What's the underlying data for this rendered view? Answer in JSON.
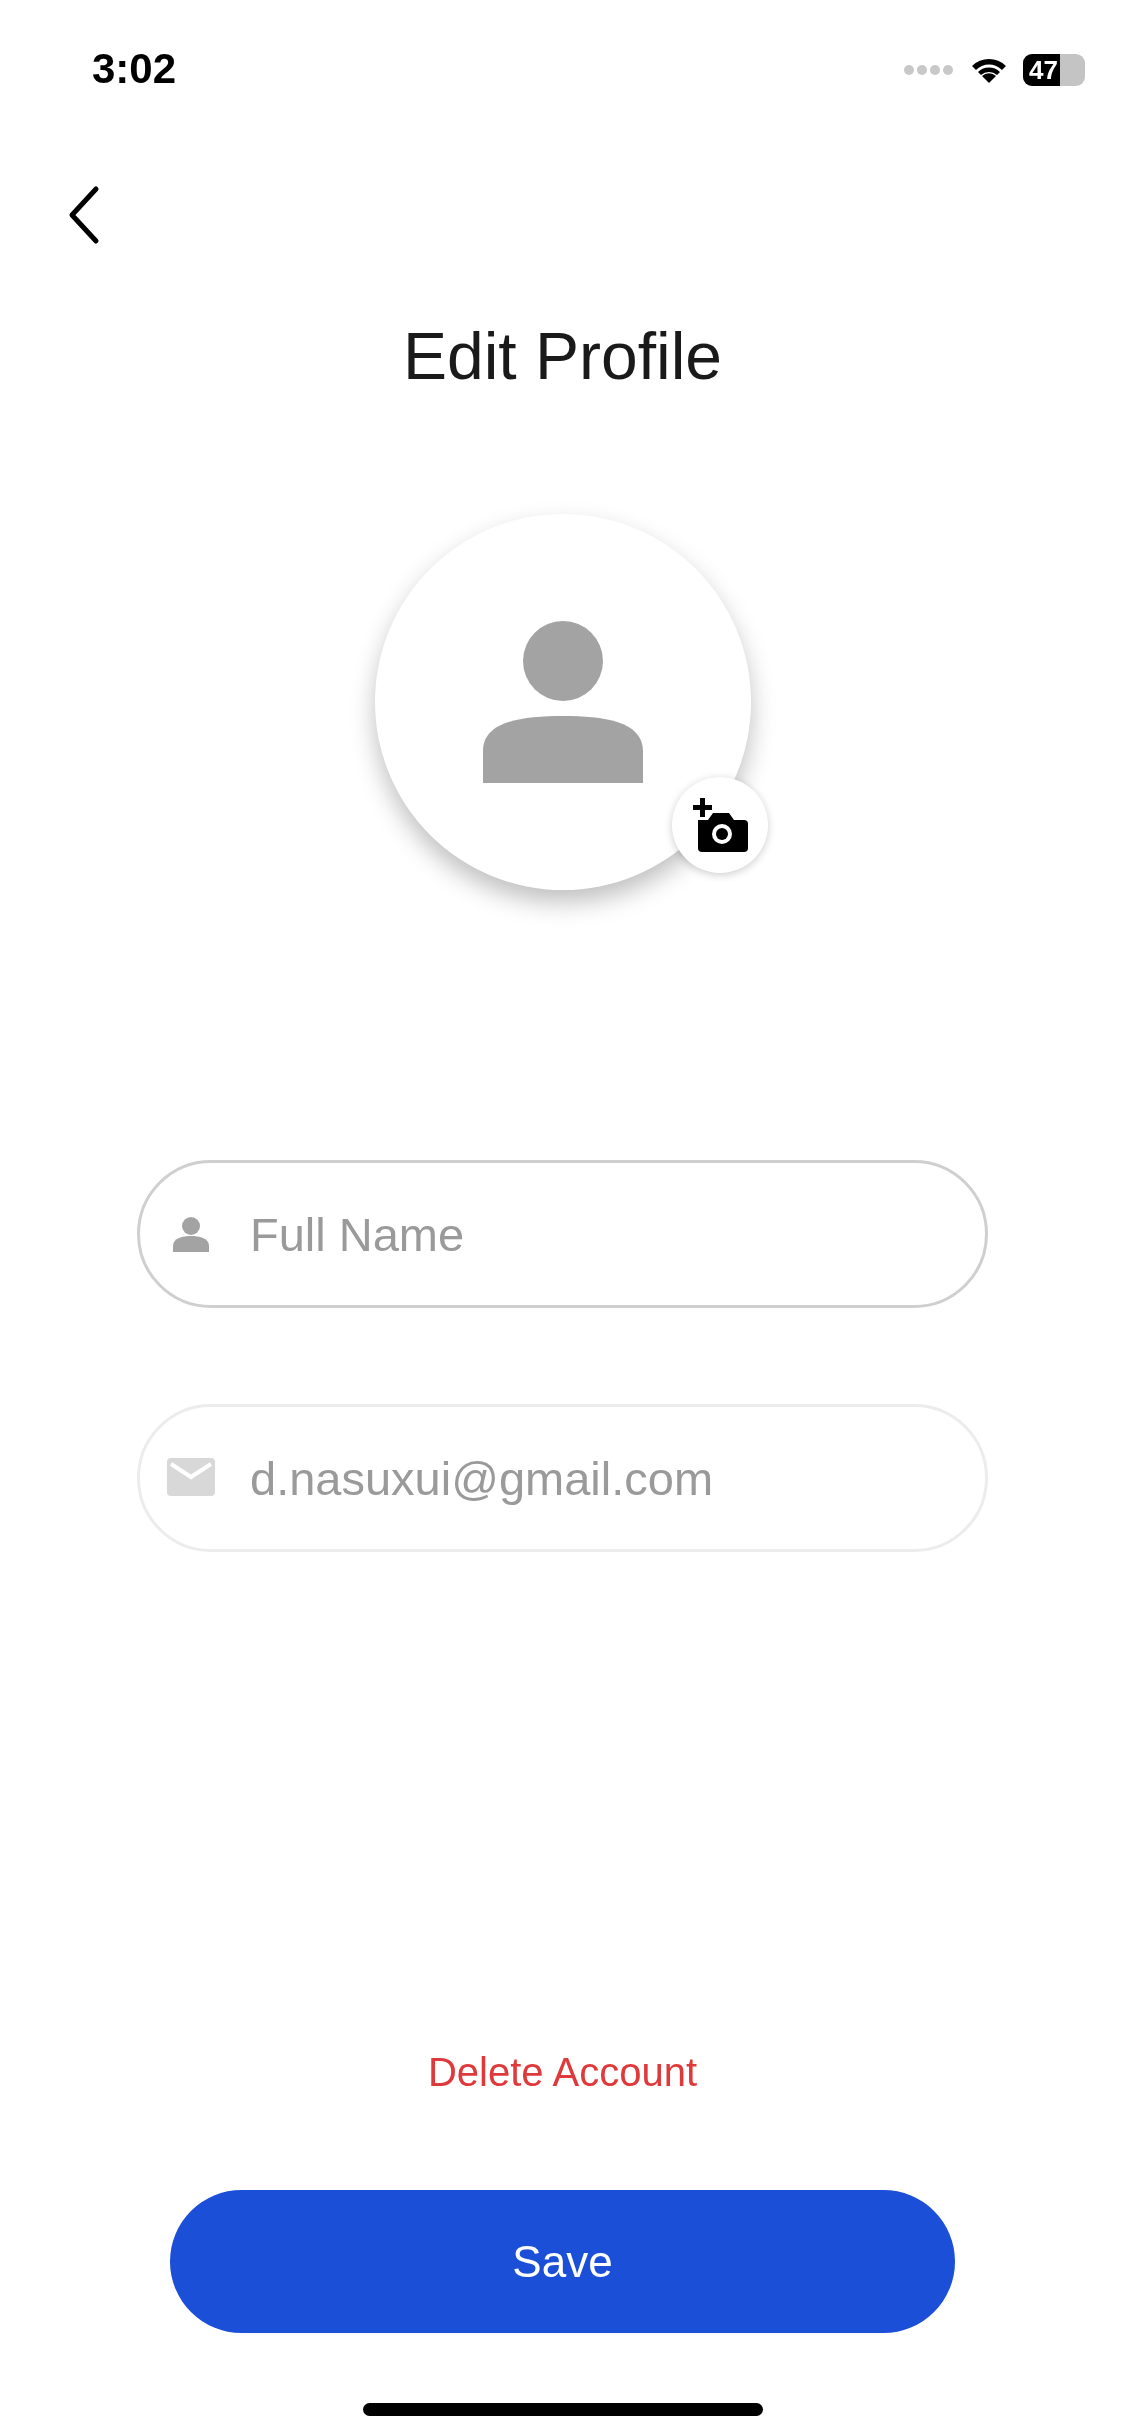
{
  "status_bar": {
    "time": "3:02",
    "battery": "47"
  },
  "title": "Edit Profile",
  "fields": [
    {
      "kind": "name",
      "placeholder": "Full Name",
      "disabled": false
    },
    {
      "kind": "email",
      "value": "d.nasuxui@gmail.com",
      "disabled": true
    }
  ],
  "delete_link": "Delete Account",
  "save_button": "Save"
}
